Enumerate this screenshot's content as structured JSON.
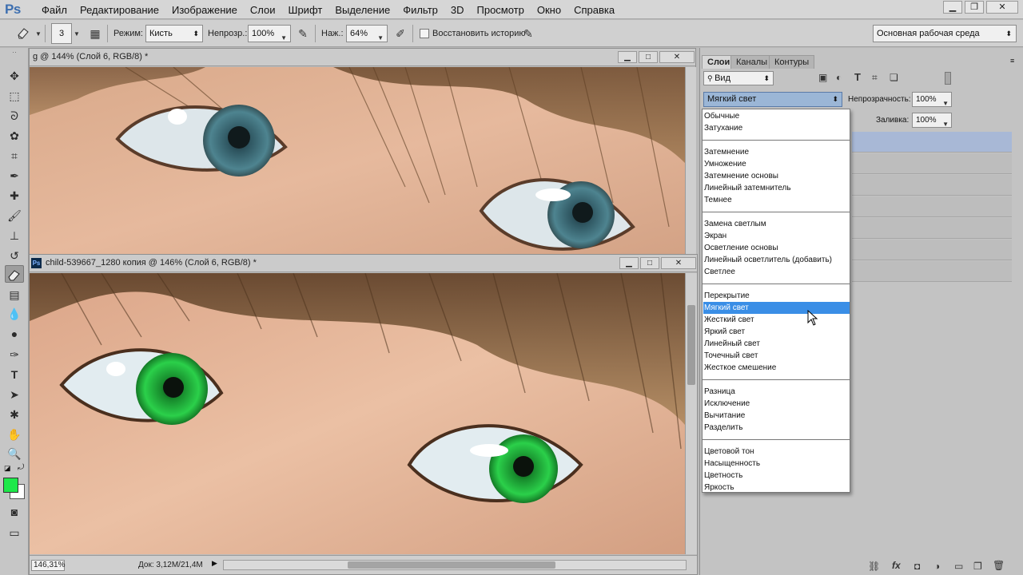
{
  "app": {
    "logo": "Ps"
  },
  "menu": [
    "Файл",
    "Редактирование",
    "Изображение",
    "Слои",
    "Шрифт",
    "Выделение",
    "Фильтр",
    "3D",
    "Просмотр",
    "Окно",
    "Справка"
  ],
  "options_bar": {
    "brush_size": "3",
    "mode_label": "Режим:",
    "mode_value": "Кисть",
    "opacity_label": "Непрозр.:",
    "opacity_value": "100%",
    "pressure_label": "Наж.:",
    "pressure_value": "64%",
    "history_label": "Восстановить историю",
    "workspace_value": "Основная рабочая среда"
  },
  "documents": {
    "back": {
      "title": "g @ 144% (Слой 6, RGB/8) *"
    },
    "front": {
      "title": "child-539667_1280 копия @ 146% (Слой 6, RGB/8) *",
      "zoom": "146,31%",
      "doc_info": "Док: 3,12M/21,4M"
    }
  },
  "layers_panel": {
    "tabs": [
      "Слои",
      "Каналы",
      "Контуры"
    ],
    "filter_value": "Вид",
    "blend_value": "Мягкий свет",
    "opacity_label": "Непрозрачность:",
    "opacity_value": "100%",
    "fill_label": "Заливка:",
    "fill_value": "100%"
  },
  "blend_modes": {
    "items": [
      "Обычные",
      "Затухание",
      "Затемнение",
      "Умножение",
      "Затемнение основы",
      "Линейный затемнитель",
      "Темнее",
      "Замена светлым",
      "Экран",
      "Осветление основы",
      "Линейный осветлитель (добавить)",
      "Светлее",
      "Перекрытие",
      "Мягкий свет",
      "Жесткий свет",
      "Яркий свет",
      "Линейный свет",
      "Точечный свет",
      "Жесткое смешение",
      "Разница",
      "Исключение",
      "Вычитание",
      "Разделить",
      "Цветовой тон",
      "Насыщенность",
      "Цветность",
      "Яркость"
    ],
    "selected": "Мягкий свет"
  },
  "colors": {
    "foreground": "#1ee84a",
    "background": "#ffffff",
    "highlight": "#3a8ee6",
    "green_iris": "#1fb33a",
    "blue_iris": "#3f7a86"
  },
  "icons": [
    "eraser-icon",
    "move-icon",
    "marquee-icon",
    "lasso-icon",
    "quick-select-icon",
    "crop-icon",
    "eyedropper-icon",
    "healing-icon",
    "brush-icon",
    "stamp-icon",
    "history-brush-icon",
    "gradient-icon",
    "blur-icon",
    "dodge-icon",
    "pen-icon",
    "type-icon",
    "path-select-icon",
    "shape-icon",
    "hand-icon",
    "zoom-icon"
  ]
}
